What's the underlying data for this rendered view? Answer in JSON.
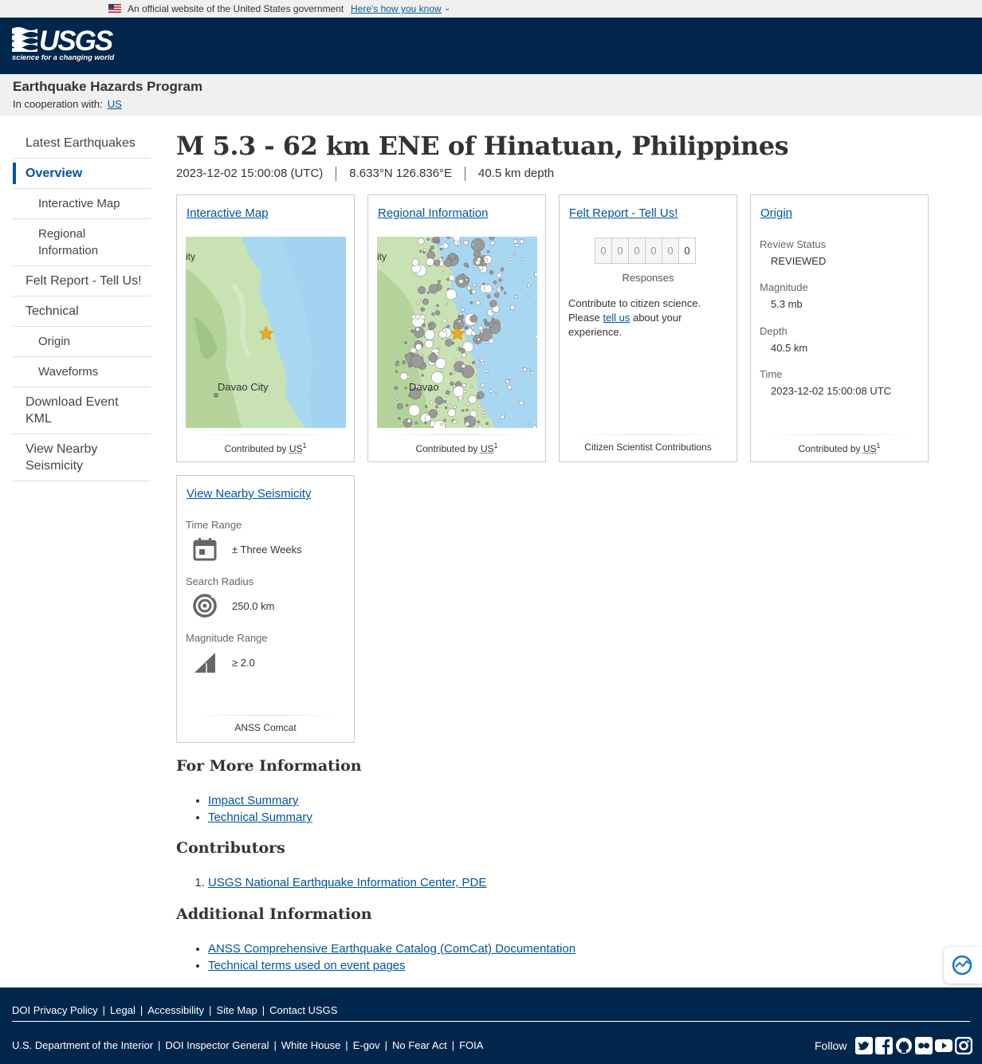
{
  "gov_banner": {
    "text": "An official website of the United States government",
    "link": "Here's how you know"
  },
  "header": {
    "logo_main": "USGS",
    "logo_tagline": "science for a changing world"
  },
  "program": {
    "title": "Earthquake Hazards Program",
    "coop_label": "In cooperation with:",
    "coop_link": "US"
  },
  "sidenav": {
    "items": [
      {
        "label": "Latest Earthquakes"
      },
      {
        "label": "Overview"
      },
      {
        "label": "Interactive Map"
      },
      {
        "label": "Regional Information"
      },
      {
        "label": "Felt Report - Tell Us!"
      },
      {
        "label": "Technical"
      },
      {
        "label": "Origin"
      },
      {
        "label": "Waveforms"
      },
      {
        "label": "Download Event KML"
      },
      {
        "label": "View Nearby Seismicity"
      }
    ]
  },
  "event": {
    "title": "M 5.3 - 62 km ENE of Hinatuan, Philippines",
    "time": "2023-12-02 15:00:08 (UTC)",
    "location": "8.633°N 126.836°E",
    "depth": "40.5 km depth"
  },
  "cards": {
    "map": {
      "link": "Interactive Map",
      "label_city": "Davao City",
      "label_edge": "ity",
      "contributed": "Contributed by",
      "contributor": "US",
      "sup": "1"
    },
    "regional": {
      "link": "Regional Information",
      "label_city": "Davao",
      "label_edge": "ity",
      "contributed": "Contributed by",
      "contributor": "US",
      "sup": "1"
    },
    "felt": {
      "link": "Felt Report - Tell Us!",
      "digits": [
        "0",
        "0",
        "0",
        "0",
        "0",
        "0"
      ],
      "responses": "Responses",
      "text_1": "Contribute to citizen science. Please",
      "text_link": "tell us",
      "text_2": "about your experience.",
      "footer": "Citizen Scientist Contributions"
    },
    "origin": {
      "link": "Origin",
      "review_status_label": "Review Status",
      "review_status": "REVIEWED",
      "magnitude_label": "Magnitude",
      "magnitude": "5.3 mb",
      "depth_label": "Depth",
      "depth": "40.5 km",
      "time_label": "Time",
      "time": "2023-12-02 15:00:08 UTC",
      "contributed": "Contributed by",
      "contributor": "US",
      "sup": "1"
    },
    "seismicity": {
      "link": "View Nearby Seismicity",
      "time_label": "Time Range",
      "time_value": "± Three Weeks",
      "radius_label": "Search Radius",
      "radius_value": "250.0 km",
      "mag_label": "Magnitude Range",
      "mag_value": "≥ 2.0",
      "footer": "ANSS Comcat"
    }
  },
  "more_info": {
    "heading": "For More Information",
    "links": [
      "Impact Summary",
      "Technical Summary"
    ]
  },
  "contributors": {
    "heading": "Contributors",
    "links": [
      "USGS National Earthquake Information Center, PDE"
    ]
  },
  "additional": {
    "heading": "Additional Information",
    "links": [
      "ANSS Comprehensive Earthquake Catalog (ComCat) Documentation",
      "Technical terms used on event pages"
    ]
  },
  "footer": {
    "row1": [
      "DOI Privacy Policy",
      "Legal",
      "Accessibility",
      "Site Map",
      "Contact USGS"
    ],
    "row2": [
      "U.S. Department of the Interior",
      "DOI Inspector General",
      "White House",
      "E-gov",
      "No Fear Act",
      "FOIA"
    ],
    "follow": "Follow",
    "social_icons": [
      "twitter-icon",
      "facebook-icon",
      "github-icon",
      "flickr-icon",
      "youtube-icon",
      "instagram-icon"
    ]
  },
  "colors": {
    "header_bg": "#00264c",
    "link": "#00539f",
    "map_water": "#a8d7f2",
    "star": "#f5a623"
  }
}
